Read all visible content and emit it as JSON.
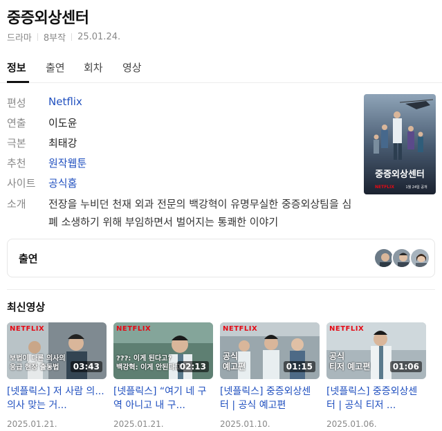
{
  "title": "중증외상센터",
  "meta": {
    "genre": "드라마",
    "episodes": "8부작",
    "date": "25.01.24."
  },
  "tabs": [
    {
      "label": "정보"
    },
    {
      "label": "출연"
    },
    {
      "label": "회차"
    },
    {
      "label": "영상"
    }
  ],
  "info": {
    "rows": [
      {
        "label": "편성",
        "value": "Netflix"
      },
      {
        "label": "연출",
        "value": "이도윤"
      },
      {
        "label": "극본",
        "value": "최태강"
      },
      {
        "label": "추천",
        "value": "원작웹툰"
      },
      {
        "label": "사이트",
        "value": "공식홈"
      }
    ],
    "synopsis_label": "소개",
    "synopsis": "전장을 누비던 천재 외과 전문의 백강혁이 유명무실한 중증외상팀을 심폐 소생하기 위해 부임하면서 벌어지는 통쾌한 이야기"
  },
  "poster": {
    "title_text": "중증외상센터",
    "brand": "NETFLIX",
    "date_text": "1월 24일 공개"
  },
  "cast": {
    "title": "출연"
  },
  "videos_section": {
    "title": "최신영상"
  },
  "videos": [
    {
      "title": "[넷플릭스] 저 사람 의...의사 맞는 거...",
      "date": "2025.01.21.",
      "duration": "03:43",
      "caption": "보법이 다른 의사의\n응급 현장 출동법",
      "brand": "NETFLIX"
    },
    {
      "title": "[넷플릭스] “여기 네 구역 아니고 내 구...",
      "date": "2025.01.21.",
      "duration": "02:13",
      "caption": "???: 이게 된다고?\n백강혁: 이게 안된다고?",
      "brand": "NETFLIX"
    },
    {
      "title": "[넷플릭스] 중증외상센터 | 공식 예고편",
      "date": "2025.01.10.",
      "duration": "01:15",
      "caption": "공식\n예고편",
      "brand": "NETFLIX"
    },
    {
      "title": "[넷플릭스] 중증외상센터 | 공식 티저 ...",
      "date": "2025.01.06.",
      "duration": "01:06",
      "caption": "공식\n티저 예고편",
      "brand": "NETFLIX"
    }
  ]
}
